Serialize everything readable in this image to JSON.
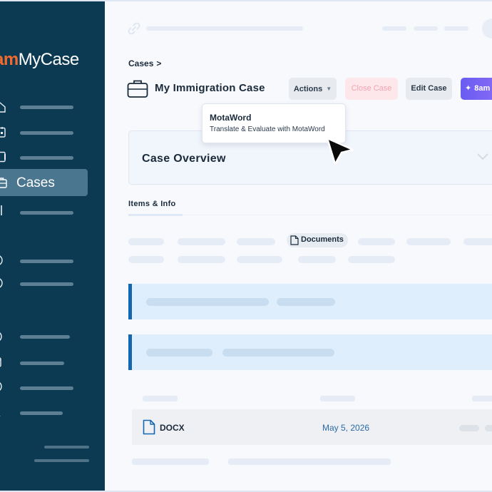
{
  "app": {
    "logo_prefix": "am",
    "logo_suffix": "MyCase"
  },
  "sidebar": {
    "active_item": "Cases"
  },
  "breadcrumb": {
    "label": "Cases",
    "separator": ">"
  },
  "case": {
    "title": "My Immigration Case"
  },
  "toolbar": {
    "actions_label": "Actions",
    "close_label": "Close Case",
    "edit_label": "Edit Case",
    "ai_label": "8am"
  },
  "dropdown": {
    "title": "MotaWord",
    "subtitle": "Translate & Evaluate with MotaWord"
  },
  "overview": {
    "title": "Case Overview"
  },
  "tabs": {
    "items_info": "Items & Info"
  },
  "documents": {
    "chip_label": "Documents",
    "row": {
      "name": "DOCX",
      "date": "May 5, 2026"
    }
  },
  "colors": {
    "sidebar": "#0b3a52",
    "brand_orange": "#f26a2e",
    "accent_blue": "#1466b0",
    "ai_purple": "#6a5cf2"
  }
}
